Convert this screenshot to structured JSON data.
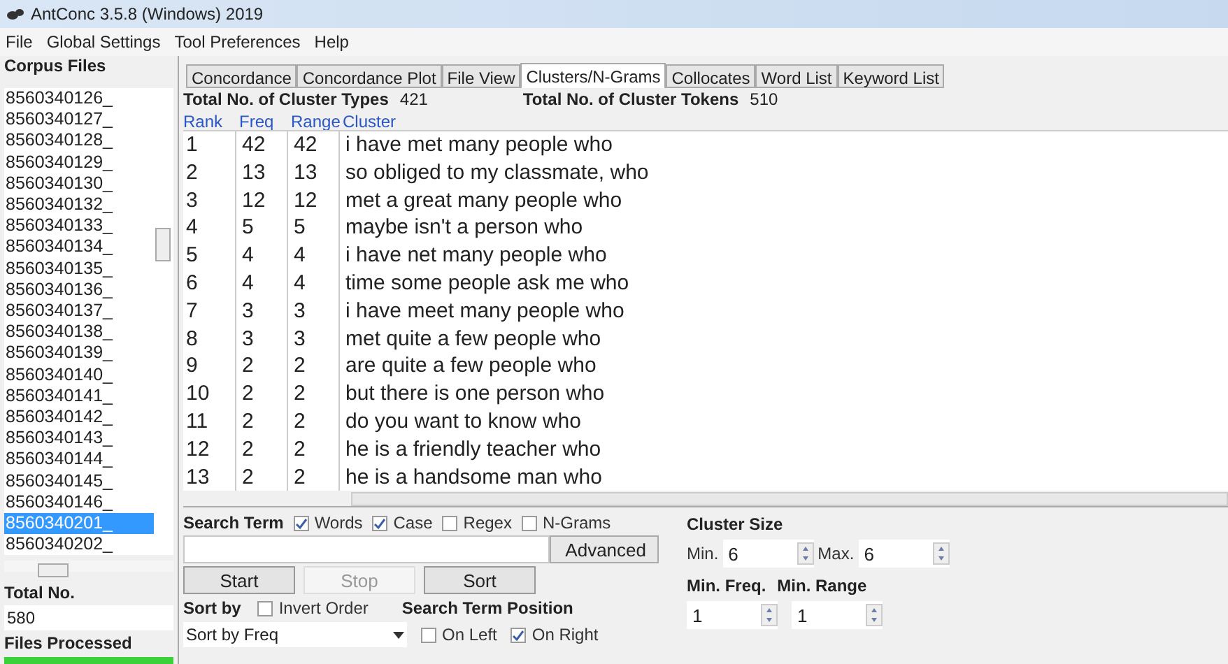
{
  "window": {
    "title": "AntConc 3.5.8 (Windows) 2019"
  },
  "menu": [
    "File",
    "Global Settings",
    "Tool Preferences",
    "Help"
  ],
  "sidebar": {
    "title": "Corpus Files",
    "files": [
      {
        "name": "8560340126_",
        "selected": false
      },
      {
        "name": "8560340127_",
        "selected": false
      },
      {
        "name": "8560340128_",
        "selected": false
      },
      {
        "name": "8560340129_",
        "selected": false
      },
      {
        "name": "8560340130_",
        "selected": false
      },
      {
        "name": "8560340132_",
        "selected": false
      },
      {
        "name": "8560340133_",
        "selected": false
      },
      {
        "name": "8560340134_",
        "selected": false
      },
      {
        "name": "8560340135_",
        "selected": false
      },
      {
        "name": "8560340136_",
        "selected": false
      },
      {
        "name": "8560340137_",
        "selected": false
      },
      {
        "name": "8560340138_",
        "selected": false
      },
      {
        "name": "8560340139_",
        "selected": false
      },
      {
        "name": "8560340140_",
        "selected": false
      },
      {
        "name": "8560340141_",
        "selected": false
      },
      {
        "name": "8560340142_",
        "selected": false
      },
      {
        "name": "8560340143_",
        "selected": false
      },
      {
        "name": "8560340144_",
        "selected": false
      },
      {
        "name": "8560340145_",
        "selected": false
      },
      {
        "name": "8560340146_",
        "selected": false
      },
      {
        "name": "8560340201_",
        "selected": true
      },
      {
        "name": "8560340202_",
        "selected": false
      }
    ],
    "total_label": "Total No.",
    "total_value": "580",
    "processed_label": "Files Processed",
    "progress": {
      "level": 1
    }
  },
  "tabs": [
    {
      "label": "Concordance",
      "selected": false
    },
    {
      "label": "Concordance Plot",
      "selected": false
    },
    {
      "label": "File View",
      "selected": false
    },
    {
      "label": "Clusters/N-Grams",
      "selected": true
    },
    {
      "label": "Collocates",
      "selected": false
    },
    {
      "label": "Word List",
      "selected": false
    },
    {
      "label": "Keyword List",
      "selected": false
    }
  ],
  "summary": {
    "types_label": "Total No. of Cluster Types",
    "types_value": "421",
    "tokens_label": "Total No. of Cluster Tokens",
    "tokens_value": "510"
  },
  "table": {
    "columns": [
      "Rank",
      "Freq",
      "Range",
      "Cluster"
    ],
    "rows": [
      [
        "1",
        "42",
        "42",
        "i have met many people who"
      ],
      [
        "2",
        "13",
        "13",
        "so obliged to my classmate, who"
      ],
      [
        "3",
        "12",
        "12",
        "met a great many people who"
      ],
      [
        "4",
        "5",
        "5",
        "maybe isn't a person who"
      ],
      [
        "5",
        "4",
        "4",
        "i have net many people who"
      ],
      [
        "6",
        "4",
        "4",
        "time some people ask me who"
      ],
      [
        "7",
        "3",
        "3",
        "i have meet many people who"
      ],
      [
        "8",
        "3",
        "3",
        "met quite a few people who"
      ],
      [
        "9",
        "2",
        "2",
        "are quite a few people who"
      ],
      [
        "10",
        "2",
        "2",
        "but there is one person who"
      ],
      [
        "11",
        "2",
        "2",
        "do you want to know who"
      ],
      [
        "12",
        "2",
        "2",
        "he is a friendly teacher who"
      ],
      [
        "13",
        "2",
        "2",
        "he is a handsome man who"
      ]
    ]
  },
  "search": {
    "label": "Search Term",
    "options": [
      {
        "label": "Words",
        "checked": true
      },
      {
        "label": "Case",
        "checked": true
      },
      {
        "label": "Regex",
        "checked": false
      },
      {
        "label": "N-Grams",
        "checked": false
      }
    ],
    "advanced": "Advanced"
  },
  "buttons": [
    {
      "label": "Start",
      "disabled": false
    },
    {
      "label": "Stop",
      "disabled": true
    },
    {
      "label": "Sort",
      "disabled": false
    }
  ],
  "sort": {
    "label": "Sort by",
    "invert": {
      "label": "Invert Order",
      "checked": false
    },
    "value": "Sort by Freq"
  },
  "position": {
    "label": "Search Term Position",
    "options": [
      {
        "label": "On Left",
        "checked": false
      },
      {
        "label": "On Right",
        "checked": true
      }
    ]
  },
  "cluster_size": {
    "label": "Cluster Size",
    "min_label": "Min.",
    "min_value": "6",
    "max_label": "Max.",
    "max_value": "6"
  },
  "thresholds": {
    "freq_label": "Min. Freq.",
    "range_label": "Min. Range",
    "freq_value": "1",
    "range_value": "1"
  }
}
